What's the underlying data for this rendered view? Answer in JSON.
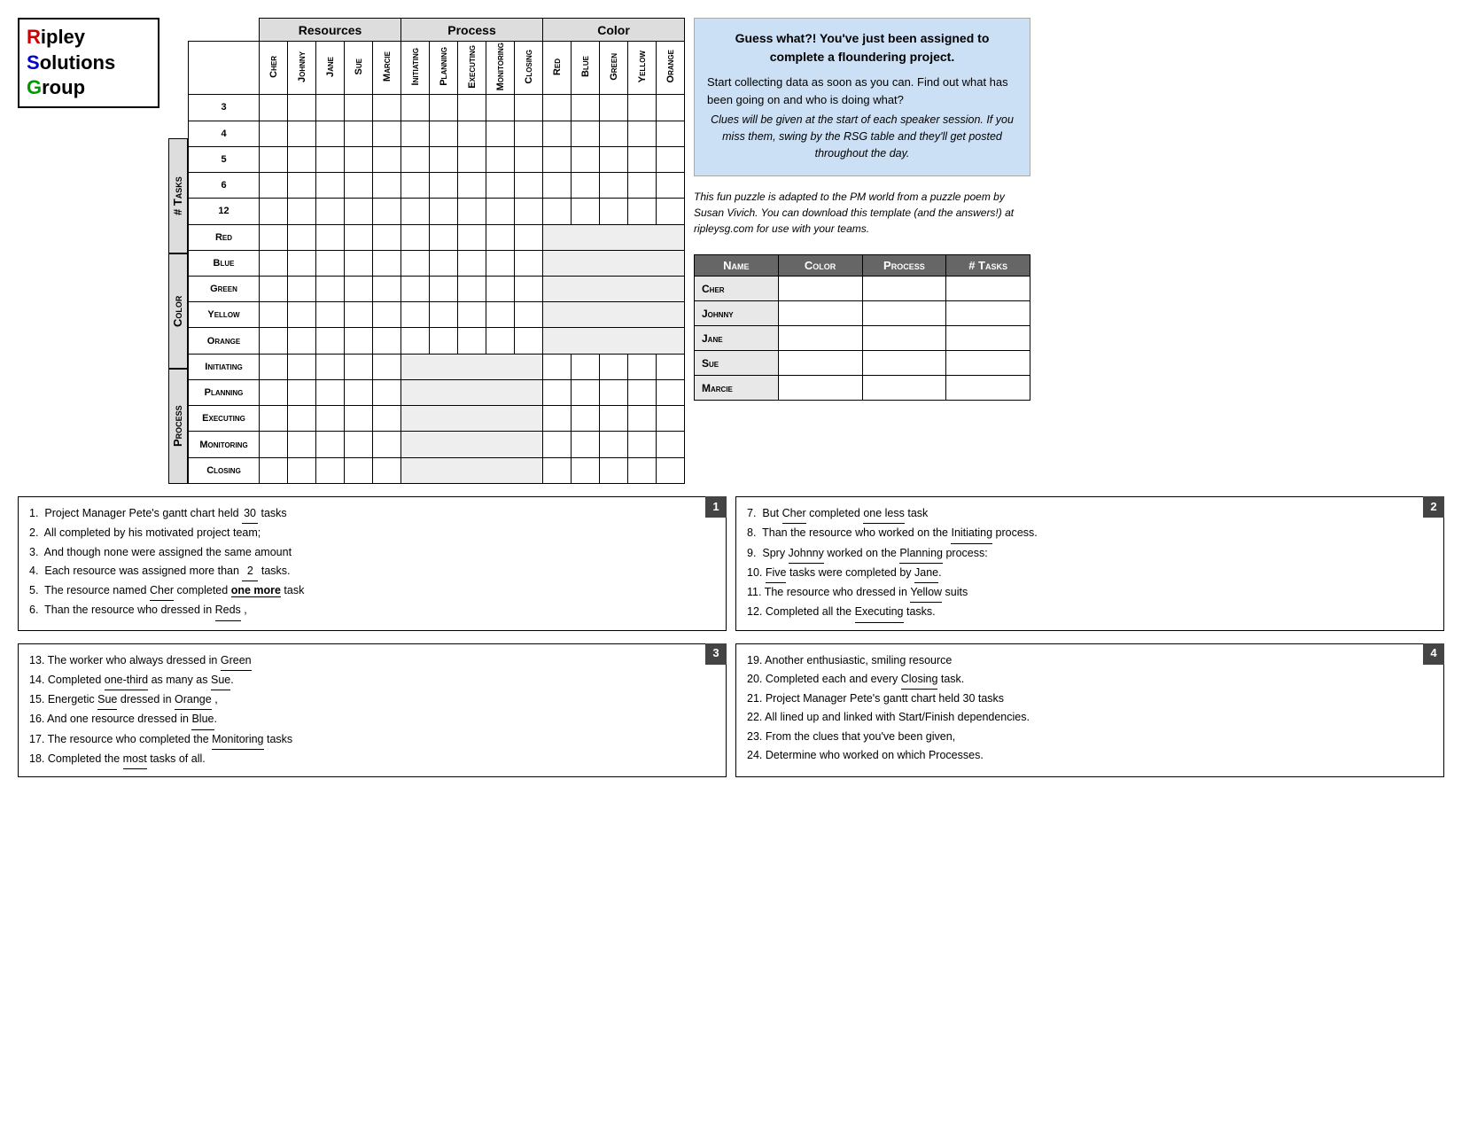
{
  "logo": {
    "line1": "ipley",
    "line2": "olutions",
    "line3": "roup",
    "r": "R",
    "s": "S",
    "g": "G"
  },
  "grid": {
    "resources_header": "Resources",
    "process_header": "Process",
    "color_header": "Color",
    "col_headers": [
      "Cher",
      "Johnny",
      "Jane",
      "Sue",
      "Marcie",
      "Initiating",
      "Planning",
      "Executing",
      "Monitoring",
      "Closing",
      "Red",
      "Blue",
      "Green",
      "Yellow",
      "Orange"
    ],
    "row_groups": [
      {
        "label": "# Tasks",
        "rows": [
          "3",
          "4",
          "5",
          "6",
          "12"
        ]
      },
      {
        "label": "Color",
        "rows": [
          "Red",
          "Blue",
          "Green",
          "Yellow",
          "Orange"
        ]
      },
      {
        "label": "Process",
        "rows": [
          "Initiating",
          "Planning",
          "Executing",
          "Monitoring",
          "Closing"
        ]
      }
    ]
  },
  "info_box": {
    "title": "Guess what?! You've just been assigned to complete a floundering project.",
    "para1": "Start collecting data as soon as you can.  Find out what has been going on and who is doing what?",
    "italic1": "Clues will be given at the start of each speaker session.  If you miss them, swing by the RSG table and they'll get posted throughout the day.",
    "para2": "This fun puzzle is adapted to the PM world from a puzzle poem by Susan Vivich.  You can download this template (and the answers!) at ripleysg.com for use with your teams."
  },
  "summary_table": {
    "headers": [
      "Name",
      "Color",
      "Process",
      "# Tasks"
    ],
    "rows": [
      {
        "name": "Cher"
      },
      {
        "name": "Johnny"
      },
      {
        "name": "Jane"
      },
      {
        "name": "Sue"
      },
      {
        "name": "Marcie"
      }
    ]
  },
  "clues": {
    "box1": {
      "number": "1",
      "lines": [
        "1.  Project Manager Pete's gantt chart held __30__ tasks",
        "2.  All completed by his motivated project team;",
        "3.  And though none were assigned the same amount",
        "4.  Each resource was assigned more than __2____ tasks.",
        "5.  The resource named __Cher__ completed _one more_ task",
        "6.  Than the resource who dressed in __Reds___ ,"
      ]
    },
    "box2": {
      "number": "2",
      "lines": [
        "7.  But __Cher_ completed _one less_____ task",
        "8.  Than the resource who worked on the _Initiating_ process.",
        "9.  Spry __Johnny_ worked on the _Planning_ process:",
        "10. _Five_ tasks were completed by _Jane____.",
        "11. The resource who dressed in _Yellow_ suits",
        "12. Completed all the _Executing___ tasks."
      ]
    },
    "box3": {
      "number": "3",
      "lines": [
        "13. The worker who always dressed in _Green____",
        "14. Completed _one-third_ as many as _Sue_____.",
        "15. Energetic _Sue__ dressed in _Orange____ ,",
        "16. And one resource dressed in _Blue____.",
        "17. The resource who completed the __Monitoring_ tasks",
        "18. Completed the _most_ tasks of all."
      ]
    },
    "box4": {
      "number": "4",
      "lines": [
        "19. Another enthusiastic, smiling resource",
        "20. Completed each and every _Closing_____ task.",
        "21. Project Manager Pete's gantt chart held 30 tasks",
        "22. All lined up and linked with Start/Finish dependencies.",
        "23. From the clues that you've been given,",
        "24. Determine who worked on which Processes."
      ]
    }
  }
}
